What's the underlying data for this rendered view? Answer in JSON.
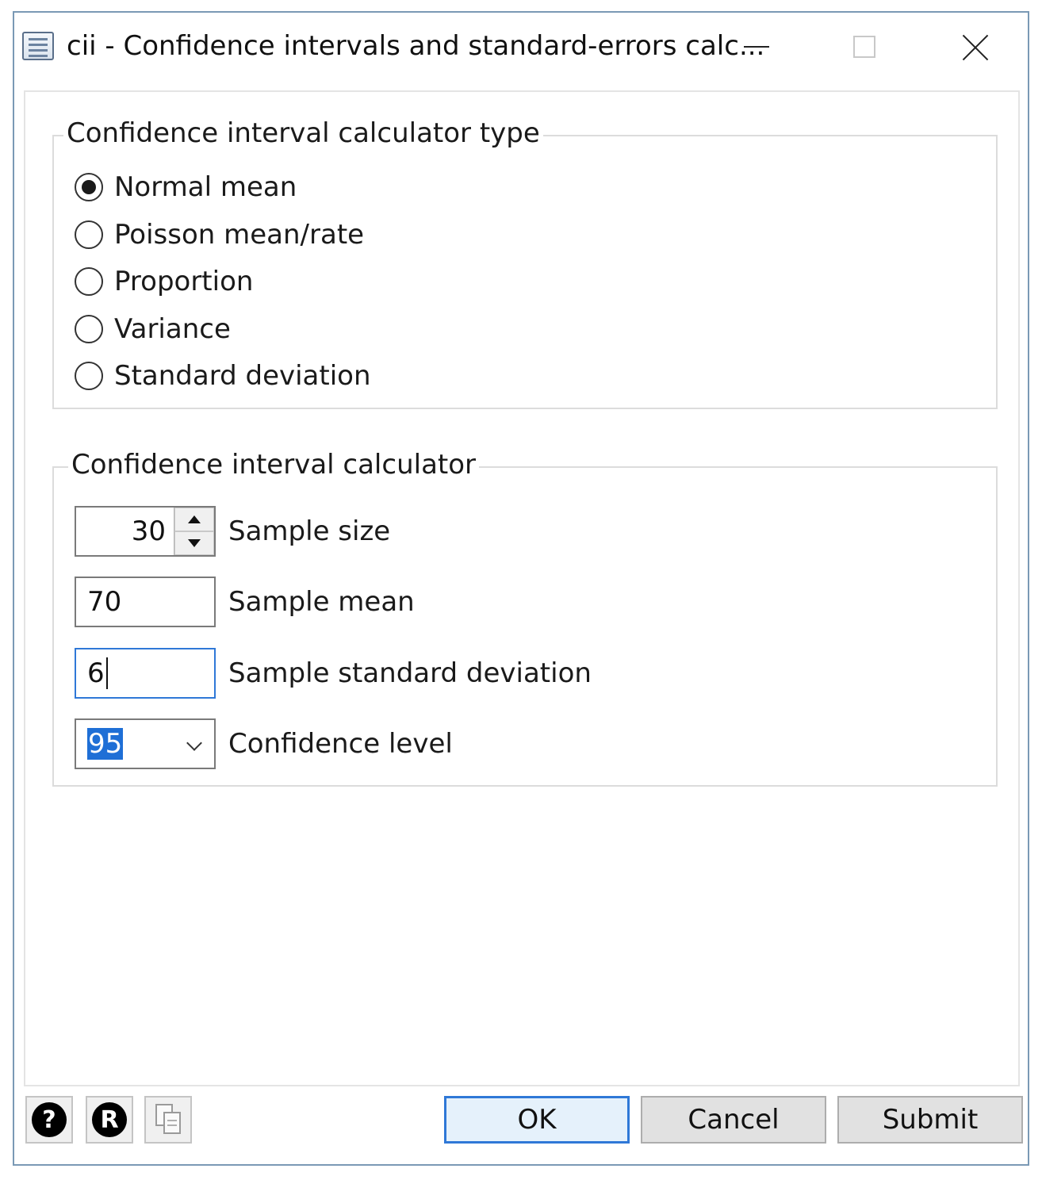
{
  "window": {
    "title": "cii - Confidence intervals and standard-errors calc..."
  },
  "type_group": {
    "title": "Confidence interval calculator type",
    "options": [
      {
        "label": "Normal mean",
        "checked": true
      },
      {
        "label": "Poisson mean/rate",
        "checked": false
      },
      {
        "label": "Proportion",
        "checked": false
      },
      {
        "label": "Variance",
        "checked": false
      },
      {
        "label": "Standard deviation",
        "checked": false
      }
    ]
  },
  "calc_group": {
    "title": "Confidence interval calculator",
    "sample_size": {
      "value": "30",
      "label": "Sample size"
    },
    "sample_mean": {
      "value": "70",
      "label": "Sample mean"
    },
    "sample_sd": {
      "value": "6",
      "label": "Sample standard deviation"
    },
    "confidence_level": {
      "value": "95",
      "label": "Confidence level"
    }
  },
  "footer": {
    "help_glyph": "?",
    "r_glyph": "R",
    "ok_label": "OK",
    "cancel_label": "Cancel",
    "submit_label": "Submit"
  },
  "colors": {
    "focus_accent": "#2f78d7",
    "selection": "#1f6fd6",
    "window_border": "#7a99b5"
  }
}
